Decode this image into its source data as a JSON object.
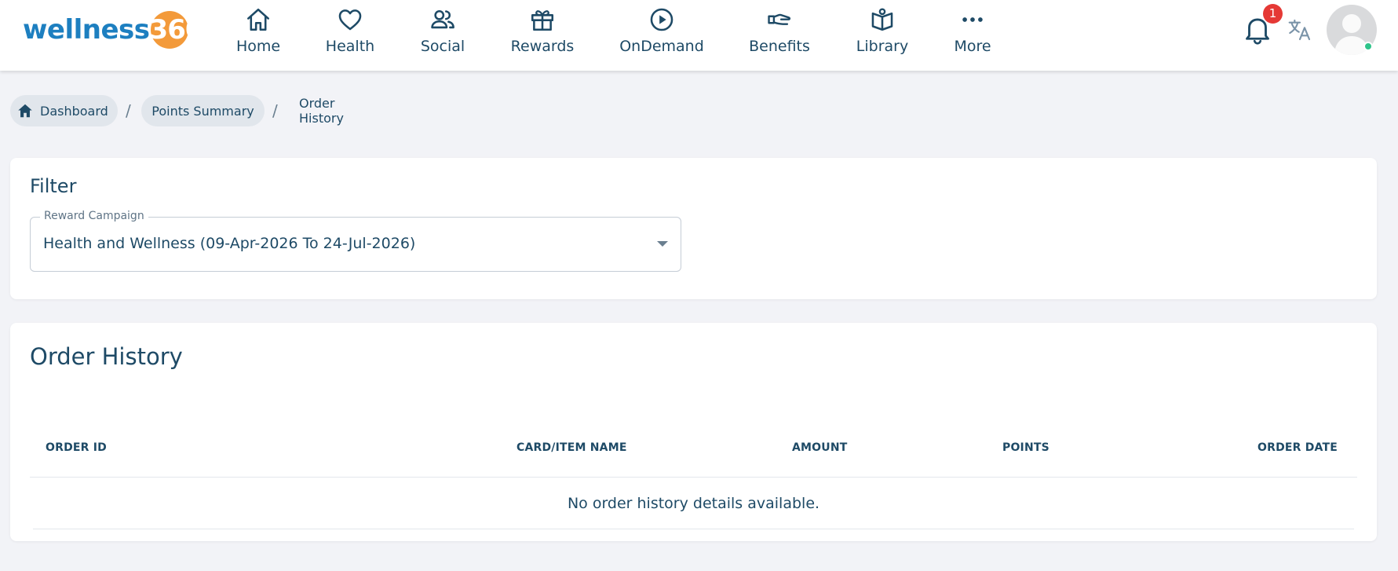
{
  "brand": {
    "logo_word": "wellness",
    "logo_number": "360",
    "word_color": "#1d7fc0",
    "number_bg_color": "#f39a3a"
  },
  "nav": {
    "items": [
      {
        "label": "Home",
        "icon": "home-icon"
      },
      {
        "label": "Health",
        "icon": "heart-icon"
      },
      {
        "label": "Social",
        "icon": "people-icon"
      },
      {
        "label": "Rewards",
        "icon": "gift-icon"
      },
      {
        "label": "OnDemand",
        "icon": "play-circle-icon"
      },
      {
        "label": "Benefits",
        "icon": "hand-icon"
      },
      {
        "label": "Library",
        "icon": "book-icon"
      },
      {
        "label": "More",
        "icon": "more-dots-icon"
      }
    ]
  },
  "header_right": {
    "notification_count": "1",
    "bell_icon": "bell-icon",
    "translate_icon": "translate-icon",
    "avatar_status_color": "#2ec48a"
  },
  "breadcrumb": {
    "items": [
      "Dashboard",
      "Points Summary",
      "Order History"
    ],
    "separator": "/",
    "home_icon": "home-icon"
  },
  "filter": {
    "title": "Filter",
    "campaign_label": "Reward Campaign",
    "campaign_value": "Health and Wellness (09-Apr-2026 To 24-Jul-2026)"
  },
  "order_history": {
    "title": "Order History",
    "columns": [
      "ORDER ID",
      "CARD/ITEM NAME",
      "AMOUNT",
      "POINTS",
      "ORDER DATE"
    ],
    "rows": [],
    "empty_message": "No order history details available."
  },
  "colors": {
    "text_primary": "#1e4a66",
    "page_bg": "#f2f3f7",
    "badge": "#e53935"
  }
}
